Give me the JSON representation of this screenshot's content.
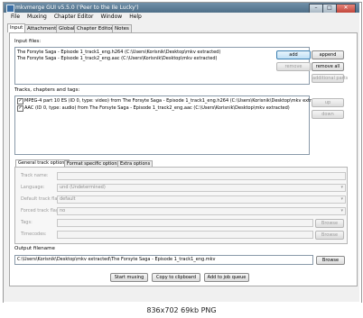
{
  "window": {
    "title": "mkvmerge GUI v5.5.0 ('Peer to the Ile Lucky')",
    "controls": [
      "–",
      "□",
      "✕"
    ]
  },
  "menu": [
    "File",
    "Muxing",
    "Chapter Editor",
    "Window",
    "Help"
  ],
  "tabs": [
    "Input",
    "Attachments",
    "Global",
    "Chapter Editor",
    "Notes"
  ],
  "input_files": {
    "label": "Input files:",
    "items": [
      "The Forsyte Saga - Episode 1_track1_eng.h264 (C:\\Users\\Korisnik\\Desktop\\mkv extracted)",
      "The Forsyte Saga - Episode 1_track2_eng.aac (C:\\Users\\Korisnik\\Desktop\\mkv extracted)"
    ],
    "buttons": {
      "add": "add",
      "append": "append",
      "remove": "remove",
      "remove_all": "remove all",
      "additional_parts": "additional parts"
    }
  },
  "tracks": {
    "label": "Tracks, chapters and tags:",
    "items": [
      {
        "checked": true,
        "text": "MPEG-4 part 10 ES (ID 0, type: video) from The Forsyte Saga - Episode 1_track1_eng.h264 (C:\\Users\\Korisnik\\Desktop\\mkv extracted)"
      },
      {
        "checked": true,
        "text": "AAC (ID 0, type: audio) from The Forsyte Saga - Episode 1_track2_eng.aac (C:\\Users\\Korisnik\\Desktop\\mkv extracted)"
      }
    ],
    "buttons": {
      "up": "up",
      "down": "down"
    }
  },
  "track_options": {
    "tabs": [
      "General track options",
      "Format specific options",
      "Extra options"
    ],
    "fields": {
      "track_name": {
        "label": "Track name:",
        "value": ""
      },
      "language": {
        "label": "Language:",
        "value": "und (Undetermined)"
      },
      "default_flag": {
        "label": "Default track flag:",
        "value": "default"
      },
      "forced_flag": {
        "label": "Forced track flag:",
        "value": "no"
      },
      "tags": {
        "label": "Tags:",
        "value": ""
      },
      "timecodes": {
        "label": "Timecodes:",
        "value": ""
      }
    },
    "browse": "Browse"
  },
  "output": {
    "label": "Output filename",
    "value": "C:\\Users\\Korisnik\\Desktop\\mkv extracted\\The Forsyte Saga - Episode 1_track1_eng.mkv",
    "browse": "Browse"
  },
  "actions": {
    "start": "Start muxing",
    "copy": "Copy to clipboard",
    "add_job": "Add to job queue"
  },
  "status": "836x702 69kb PNG"
}
